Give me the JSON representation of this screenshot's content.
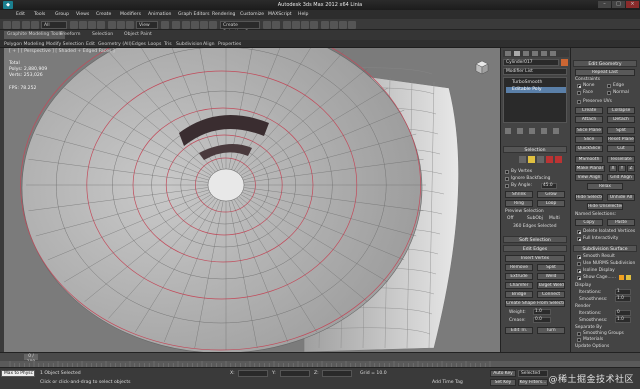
{
  "window": {
    "title": "Autodesk 3ds Max 2012 x64 Linia"
  },
  "menubar": [
    "Edit",
    "Tools",
    "Group",
    "Views",
    "Create",
    "Modifiers",
    "Animation",
    "Graph Editors",
    "Rendering",
    "Customize",
    "MAXScript",
    "Help"
  ],
  "toolbar": {
    "selection_filter": "All",
    "view_dropdown": "View",
    "named_sel": "Create Selection Se"
  },
  "ribbon": {
    "tabs": [
      "Graphite Modeling Tools",
      "Freeform",
      "Selection",
      "Object Paint"
    ],
    "subtabs": [
      "Polygon Modeling",
      "Modify Selection",
      "Edit",
      "Geometry (All)",
      "Edges",
      "Loops",
      "Tris",
      "Subdivision",
      "Align",
      "Properties"
    ]
  },
  "viewport": {
    "label": "[ + ] [ Perspective ] [ Shaded + Edged Faces ]",
    "stats": {
      "header": "Total",
      "polys_label": "Polys:",
      "polys": "2,880,909",
      "verts_label": "Verts:",
      "verts": "253,026"
    },
    "fps_label": "FPS:",
    "fps": "78.252"
  },
  "cmdpanel": {
    "object_name": "Cylinder017",
    "modifier_list": "Modifier List",
    "stack": [
      "TurboSmooth",
      "Editable Poly"
    ],
    "selection_title": "Selection",
    "by_vertex": "By Vertex",
    "ignore_backfacing": "Ignore Backfacing",
    "by_angle": "By Angle:",
    "by_angle_val": "45.0",
    "shrink": "Shrink",
    "grow": "Grow",
    "ring": "Ring",
    "loop": "Loop",
    "preview_sel": "Preview Selection",
    "off": "Off",
    "subobj": "SubObj",
    "multi": "Multi",
    "edges_selected": "360 Edges Selected",
    "soft_sel": "Soft Selection",
    "edit_edges": "Edit Edges",
    "insert_vertex": "Insert Vertex",
    "remove": "Remove",
    "split": "Split",
    "extrude": "Extrude",
    "weld": "Weld",
    "chamfer": "Chamfer",
    "target_weld": "Target Weld",
    "bridge": "Bridge",
    "connect": "Connect",
    "create_shape": "Create Shape From Selection",
    "weight": "Weight:",
    "weight_val": "1.0",
    "crease": "Crease:",
    "crease_val": "0.0",
    "edit_tri": "Edit Tri.",
    "turn": "Turn"
  },
  "editgeom": {
    "title": "Edit Geometry",
    "repeat_last": "Repeat Last",
    "constraints": "Constraints",
    "none": "None",
    "edge": "Edge",
    "face": "Face",
    "normal": "Normal",
    "preserve_uvs": "Preserve UVs",
    "create": "Create",
    "collapse": "Collapse",
    "attach": "Attach",
    "detach": "Detach",
    "slice_plane": "Slice Plane",
    "split": "Split",
    "slice": "Slice",
    "reset_plane": "Reset Plane",
    "quickslice": "QuickSlice",
    "cut": "Cut",
    "msmooth": "MSmooth",
    "tessellate": "Tessellate",
    "make_planar": "Make Planar",
    "x": "X",
    "y": "Y",
    "z": "Z",
    "view_align": "View Align",
    "grid_align": "Grid Align",
    "relax": "Relax",
    "hide_sel": "Hide Selected",
    "unhide_all": "Unhide All",
    "hide_unsel": "Hide Unselected",
    "named_sel": "Named Selections:",
    "copy": "Copy",
    "paste": "Paste",
    "delete_isolated": "Delete Isolated Vertices",
    "full_interactivity": "Full Interactivity",
    "subdiv_title": "Subdivision Surface",
    "smooth_result": "Smooth Result",
    "use_nurms": "Use NURMS Subdivision",
    "isoline": "Isoline Display",
    "show_cage": "Show Cage......",
    "display": "Display",
    "iterations": "Iterations:",
    "iter_val": "1",
    "smoothness": "Smoothness:",
    "smooth_val": "1.0",
    "render": "Render",
    "r_iterations": "Iterations:",
    "r_iter_val": "0",
    "r_smoothness": "Smoothness:",
    "r_smooth_val": "1.0",
    "separate_by": "Separate By",
    "smoothing_groups": "Smoothing Groups",
    "materials": "Materials",
    "update_options": "Update Options",
    "always": "Always",
    "when_rendering": "When Rendering",
    "manually": "Manually"
  },
  "timeline": {
    "frame": "0 / 100"
  },
  "status": {
    "script_label": "Max to Physc",
    "objects_selected": "1 Object Selected",
    "hint": "Click or click-and-drag to select objects",
    "x_label": "X:",
    "y_label": "Y:",
    "z_label": "Z:",
    "grid": "Grid = 10.0",
    "autokey": "Auto Key",
    "selected": "Selected",
    "setkey": "Set Key",
    "keyfilters": "Key Filters...",
    "add_time_tag": "Add Time Tag"
  },
  "watermark": "@稀土掘金技术社区"
}
